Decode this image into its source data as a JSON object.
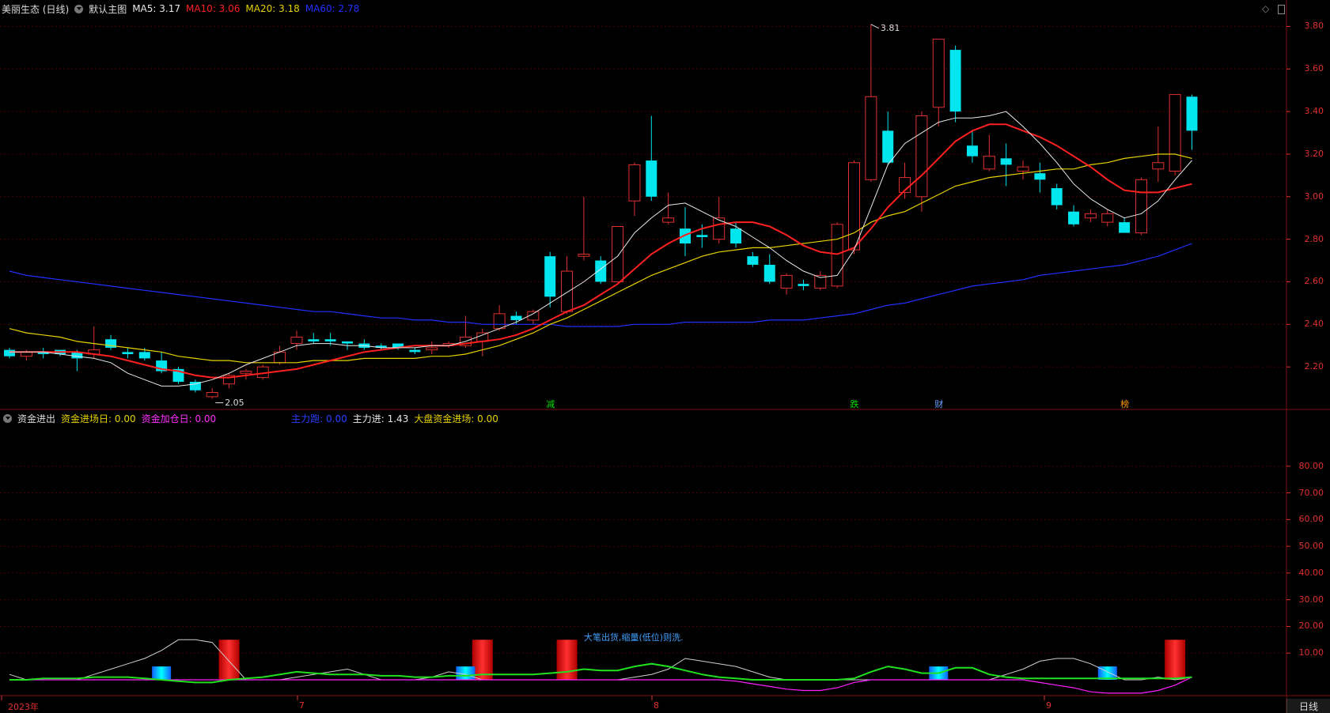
{
  "main_header": {
    "stock": "美丽生态 (日线)",
    "template": "默认主图",
    "ma5": "MA5: 3.17",
    "ma10": "MA10: 3.06",
    "ma20": "MA20: 3.18",
    "ma60": "MA60: 2.78"
  },
  "sub_header": {
    "title": "资金进出",
    "entry_day": "资金进场日: 0.00",
    "add_day": "资金加仓日: 0.00",
    "main_out": "主力跑: 0.00",
    "main_in": "主力进: 1.43",
    "big_entry": "大盘资金进场: 0.00"
  },
  "colors": {
    "up": "#e03030",
    "down": "#00e5ee",
    "ma5": "#e8e8e8",
    "ma10": "#ff2020",
    "ma20": "#e6d200",
    "ma60": "#2030ff",
    "grid": "#4a0000"
  },
  "price_axis": [
    "3.80",
    "3.60",
    "3.40",
    "3.20",
    "3.00",
    "2.80",
    "2.60",
    "2.40",
    "2.20"
  ],
  "sub_axis": [
    "80.00",
    "70.00",
    "60.00",
    "50.00",
    "40.00",
    "30.00",
    "20.00",
    "10.00"
  ],
  "x_axis": [
    "2023年",
    "7",
    "8",
    "9"
  ],
  "bottom_tab": "日线",
  "annotations": {
    "high": "3.81",
    "low": "2.05",
    "note": "大笔出货,缩量(低位)则洗."
  },
  "signals": [
    {
      "text": "减",
      "color": "#00e000"
    },
    {
      "text": "跌",
      "color": "#00e000"
    },
    {
      "text": "财",
      "color": "#6aa0ff"
    },
    {
      "text": "榜",
      "color": "#ff9900"
    }
  ],
  "chart_data": {
    "type": "candlestick",
    "ylim": [
      2.0,
      3.85
    ],
    "candles": [
      [
        2.28,
        2.25,
        2.29,
        2.24
      ],
      [
        2.25,
        2.27,
        2.28,
        2.23
      ],
      [
        2.27,
        2.26,
        2.29,
        2.24
      ],
      [
        2.28,
        2.26,
        2.28,
        2.25
      ],
      [
        2.27,
        2.24,
        2.28,
        2.18
      ],
      [
        2.26,
        2.28,
        2.39,
        2.24
      ],
      [
        2.33,
        2.29,
        2.35,
        2.28
      ],
      [
        2.27,
        2.26,
        2.29,
        2.24
      ],
      [
        2.27,
        2.24,
        2.29,
        2.23
      ],
      [
        2.23,
        2.18,
        2.27,
        2.17
      ],
      [
        2.19,
        2.13,
        2.2,
        2.12
      ],
      [
        2.13,
        2.09,
        2.14,
        2.08
      ],
      [
        2.06,
        2.08,
        2.1,
        2.05
      ],
      [
        2.12,
        2.16,
        2.17,
        2.1
      ],
      [
        2.17,
        2.18,
        2.19,
        2.14
      ],
      [
        2.15,
        2.2,
        2.21,
        2.14
      ],
      [
        2.22,
        2.27,
        2.3,
        2.21
      ],
      [
        2.31,
        2.34,
        2.37,
        2.28
      ],
      [
        2.33,
        2.32,
        2.36,
        2.31
      ],
      [
        2.33,
        2.32,
        2.36,
        2.3
      ],
      [
        2.32,
        2.31,
        2.32,
        2.28
      ],
      [
        2.31,
        2.29,
        2.33,
        2.28
      ],
      [
        2.3,
        2.29,
        2.31,
        2.28
      ],
      [
        2.31,
        2.29,
        2.31,
        2.28
      ],
      [
        2.28,
        2.27,
        2.29,
        2.26
      ],
      [
        2.28,
        2.29,
        2.32,
        2.26
      ],
      [
        2.3,
        2.31,
        2.32,
        2.29
      ],
      [
        2.3,
        2.34,
        2.44,
        2.29
      ],
      [
        2.32,
        2.36,
        2.38,
        2.25
      ],
      [
        2.38,
        2.45,
        2.49,
        2.37
      ],
      [
        2.44,
        2.42,
        2.46,
        2.4
      ],
      [
        2.42,
        2.46,
        2.47,
        2.4
      ],
      [
        2.72,
        2.53,
        2.74,
        2.48
      ],
      [
        2.46,
        2.65,
        2.72,
        2.45
      ],
      [
        2.72,
        2.73,
        3.0,
        2.7
      ],
      [
        2.7,
        2.6,
        2.72,
        2.59
      ],
      [
        2.6,
        2.86,
        2.86,
        2.6
      ],
      [
        2.98,
        3.15,
        3.16,
        2.91
      ],
      [
        3.17,
        3.0,
        3.38,
        2.98
      ],
      [
        2.88,
        2.9,
        3.02,
        2.87
      ],
      [
        2.85,
        2.78,
        2.95,
        2.72
      ],
      [
        2.82,
        2.81,
        2.87,
        2.76
      ],
      [
        2.8,
        2.9,
        3.0,
        2.78
      ],
      [
        2.85,
        2.78,
        2.88,
        2.76
      ],
      [
        2.72,
        2.68,
        2.74,
        2.67
      ],
      [
        2.68,
        2.6,
        2.73,
        2.59
      ],
      [
        2.57,
        2.63,
        2.64,
        2.54
      ],
      [
        2.59,
        2.58,
        2.61,
        2.56
      ],
      [
        2.57,
        2.63,
        2.65,
        2.56
      ],
      [
        2.58,
        2.87,
        2.88,
        2.57
      ],
      [
        2.75,
        3.16,
        3.17,
        2.73
      ],
      [
        3.08,
        3.47,
        3.81,
        3.07
      ],
      [
        3.31,
        3.16,
        3.4,
        3.15
      ],
      [
        3.02,
        3.09,
        3.16,
        2.99
      ],
      [
        3.0,
        3.38,
        3.4,
        2.93
      ],
      [
        3.42,
        3.74,
        3.74,
        3.33
      ],
      [
        3.69,
        3.4,
        3.71,
        3.35
      ],
      [
        3.24,
        3.19,
        3.31,
        3.16
      ],
      [
        3.13,
        3.19,
        3.29,
        3.12
      ],
      [
        3.18,
        3.15,
        3.25,
        3.05
      ],
      [
        3.12,
        3.14,
        3.17,
        3.08
      ],
      [
        3.11,
        3.08,
        3.16,
        3.02
      ],
      [
        3.04,
        2.96,
        3.06,
        2.94
      ],
      [
        2.93,
        2.87,
        2.96,
        2.86
      ],
      [
        2.9,
        2.92,
        2.94,
        2.88
      ],
      [
        2.88,
        2.92,
        2.94,
        2.86
      ],
      [
        2.88,
        2.83,
        2.9,
        2.83
      ],
      [
        2.83,
        3.08,
        3.09,
        2.82
      ],
      [
        3.13,
        3.16,
        3.33,
        3.07
      ],
      [
        3.12,
        3.48,
        3.48,
        3.1
      ],
      [
        3.47,
        3.31,
        3.48,
        3.22
      ]
    ],
    "ma5": [
      2.27,
      2.27,
      2.27,
      2.26,
      2.25,
      2.24,
      2.22,
      2.17,
      2.14,
      2.11,
      2.11,
      2.12,
      2.14,
      2.17,
      2.21,
      2.24,
      2.27,
      2.3,
      2.31,
      2.31,
      2.3,
      2.3,
      2.29,
      2.29,
      2.29,
      2.3,
      2.3,
      2.32,
      2.35,
      2.38,
      2.41,
      2.45,
      2.5,
      2.55,
      2.6,
      2.66,
      2.72,
      2.83,
      2.9,
      2.96,
      2.97,
      2.93,
      2.89,
      2.86,
      2.81,
      2.76,
      2.7,
      2.65,
      2.62,
      2.63,
      2.75,
      2.95,
      3.15,
      3.25,
      3.3,
      3.35,
      3.37,
      3.37,
      3.38,
      3.4,
      3.33,
      3.25,
      3.16,
      3.06,
      2.99,
      2.94,
      2.9,
      2.92,
      2.98,
      3.08,
      3.17
    ],
    "ma10": [
      2.27,
      2.27,
      2.27,
      2.27,
      2.27,
      2.26,
      2.25,
      2.23,
      2.21,
      2.19,
      2.18,
      2.16,
      2.15,
      2.15,
      2.16,
      2.17,
      2.18,
      2.19,
      2.21,
      2.23,
      2.25,
      2.27,
      2.28,
      2.29,
      2.3,
      2.3,
      2.3,
      2.31,
      2.32,
      2.33,
      2.35,
      2.38,
      2.42,
      2.46,
      2.49,
      2.54,
      2.59,
      2.66,
      2.73,
      2.78,
      2.82,
      2.85,
      2.87,
      2.88,
      2.88,
      2.86,
      2.82,
      2.77,
      2.74,
      2.73,
      2.76,
      2.85,
      2.95,
      3.03,
      3.1,
      3.18,
      3.26,
      3.31,
      3.34,
      3.34,
      3.31,
      3.28,
      3.24,
      3.19,
      3.14,
      3.08,
      3.03,
      3.02,
      3.02,
      3.04,
      3.06
    ],
    "ma20": [
      2.38,
      2.36,
      2.35,
      2.34,
      2.32,
      2.31,
      2.3,
      2.29,
      2.28,
      2.27,
      2.25,
      2.24,
      2.23,
      2.23,
      2.22,
      2.22,
      2.22,
      2.22,
      2.23,
      2.23,
      2.23,
      2.24,
      2.24,
      2.24,
      2.24,
      2.25,
      2.25,
      2.26,
      2.28,
      2.3,
      2.33,
      2.36,
      2.4,
      2.43,
      2.47,
      2.51,
      2.55,
      2.59,
      2.63,
      2.66,
      2.69,
      2.72,
      2.74,
      2.75,
      2.76,
      2.76,
      2.77,
      2.78,
      2.79,
      2.8,
      2.83,
      2.88,
      2.91,
      2.93,
      2.97,
      3.01,
      3.05,
      3.07,
      3.09,
      3.1,
      3.11,
      3.12,
      3.13,
      3.13,
      3.15,
      3.16,
      3.18,
      3.19,
      3.2,
      3.2,
      3.18
    ],
    "ma60": [
      2.65,
      2.63,
      2.62,
      2.61,
      2.6,
      2.59,
      2.58,
      2.57,
      2.56,
      2.55,
      2.54,
      2.53,
      2.52,
      2.51,
      2.5,
      2.49,
      2.48,
      2.47,
      2.46,
      2.46,
      2.45,
      2.44,
      2.43,
      2.43,
      2.42,
      2.42,
      2.41,
      2.41,
      2.4,
      2.4,
      2.4,
      2.4,
      2.4,
      2.39,
      2.39,
      2.39,
      2.39,
      2.4,
      2.4,
      2.4,
      2.41,
      2.41,
      2.41,
      2.41,
      2.41,
      2.42,
      2.42,
      2.42,
      2.43,
      2.44,
      2.45,
      2.47,
      2.49,
      2.5,
      2.52,
      2.54,
      2.56,
      2.58,
      2.59,
      2.6,
      2.61,
      2.63,
      2.64,
      2.65,
      2.66,
      2.67,
      2.68,
      2.7,
      2.72,
      2.75,
      2.78
    ],
    "sub_ylim": [
      0,
      90
    ],
    "sub_white": [
      2,
      0,
      0,
      0,
      0,
      2,
      4,
      6,
      8,
      11,
      15,
      15,
      14,
      7,
      0,
      0,
      0,
      1,
      2,
      3,
      4,
      2,
      0,
      0,
      0,
      1,
      3,
      2,
      0,
      0,
      0,
      0,
      0,
      0,
      0,
      0,
      0,
      1,
      2,
      4,
      8,
      7,
      6,
      5,
      3,
      1,
      0,
      0,
      0,
      0,
      0,
      0,
      0,
      0,
      0,
      0,
      0,
      0,
      0,
      2,
      4,
      7,
      8,
      8,
      6,
      3,
      0,
      0,
      1,
      0,
      1
    ],
    "sub_green": [
      0,
      0,
      0.5,
      0.5,
      0.5,
      1,
      1,
      1,
      0.5,
      0,
      -0.5,
      -1,
      -1,
      0,
      0.5,
      1,
      2,
      3,
      2.5,
      2,
      2,
      2,
      1.5,
      1.5,
      1,
      1,
      1.5,
      1.5,
      2,
      2,
      2,
      2,
      2.5,
      3,
      4,
      3.5,
      3.5,
      5,
      6,
      5,
      3.5,
      2,
      1,
      0.5,
      0,
      0,
      0,
      0,
      0,
      0,
      0.5,
      3,
      5,
      4,
      2.5,
      2.5,
      4.5,
      4.5,
      2,
      1,
      0.5,
      0.5,
      0.5,
      0.5,
      0.5,
      0.5,
      0.5,
      0.5,
      0.5,
      0.5,
      1
    ],
    "sub_magenta": [
      0,
      0,
      0,
      0,
      0,
      0,
      0,
      0,
      0,
      0,
      0,
      0,
      0,
      0,
      0,
      0,
      0,
      0,
      0,
      0,
      0,
      0,
      0,
      0,
      0,
      0,
      0,
      0,
      0,
      0,
      0,
      0,
      0,
      0,
      0,
      0,
      0,
      0,
      0,
      0,
      0,
      0,
      0,
      -0.5,
      -1.5,
      -2.5,
      -3.5,
      -4,
      -4,
      -3,
      -1,
      0,
      0,
      0,
      0,
      0,
      0,
      0,
      0,
      0,
      0,
      -1,
      -2,
      -3,
      -4.5,
      -5,
      -5,
      -5,
      -4,
      -2,
      1
    ],
    "sub_red_bars": [
      13,
      28,
      33,
      69
    ],
    "sub_cyan_bars": [
      9,
      27,
      55,
      65
    ]
  }
}
